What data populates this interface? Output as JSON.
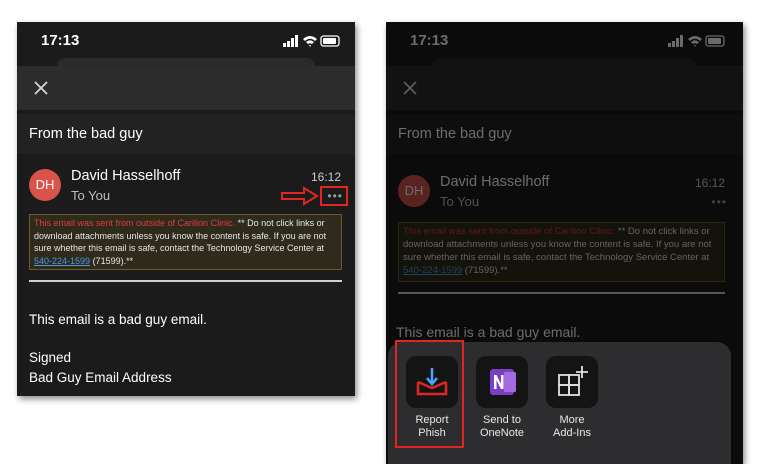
{
  "status": {
    "time": "17:13"
  },
  "email": {
    "subject": "From the bad guy",
    "avatar_initials": "DH",
    "sender": "David Hasselhoff",
    "recipient": "To You",
    "time": "16:12",
    "more_glyph": "•••",
    "banner": {
      "warning": "This email was sent from outside of Carilion Clinic.",
      "text1": " ** Do not click links or download attachments unless you know the content is safe. If you are not sure whether this email is safe, contact the Technology Service Center at ",
      "phone": "540-224-1599",
      "text2": " (71599).**"
    },
    "body": "This email is a bad guy email.",
    "signed": "Signed",
    "signature": "Bad Guy Email Address"
  },
  "actions": [
    {
      "label1": "Report",
      "label2": "Phish",
      "icon": "report-phish-icon"
    },
    {
      "label1": "Send to",
      "label2": "OneNote",
      "icon": "onenote-icon"
    },
    {
      "label1": "More",
      "label2": "Add-Ins",
      "icon": "add-ins-icon"
    }
  ],
  "colors": {
    "avatar": "#d9534a",
    "warning_red": "#e03a3a",
    "highlight_red": "#e0261e",
    "onenote_purple": "#7b3fc4",
    "link_blue": "#4a9be0"
  }
}
